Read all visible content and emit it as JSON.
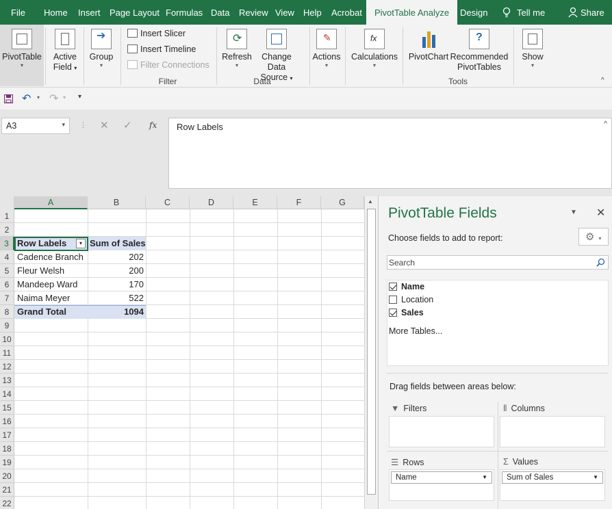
{
  "tabs": [
    "File",
    "Home",
    "Insert",
    "Page Layout",
    "Formulas",
    "Data",
    "Review",
    "View",
    "Help",
    "Acrobat",
    "PivotTable Analyze",
    "Design"
  ],
  "tell_me": "Tell me",
  "share": "Share",
  "ribbon": {
    "pivottable": "PivotTable",
    "active_field_1": "Active",
    "active_field_2": "Field",
    "group": "Group",
    "insert_slicer": "Insert Slicer",
    "insert_timeline": "Insert Timeline",
    "filter_connections": "Filter Connections",
    "filter_group": "Filter",
    "refresh": "Refresh",
    "change_data_1": "Change Data",
    "change_data_2": "Source",
    "data_group": "Data",
    "actions": "Actions",
    "calculations": "Calculations",
    "pivotchart": "PivotChart",
    "recommended_1": "Recommended",
    "recommended_2": "PivotTables",
    "tools_group": "Tools",
    "show": "Show"
  },
  "formula_bar": {
    "name_box": "A3",
    "fx": "fx",
    "content": "Row Labels"
  },
  "grid": {
    "columns": [
      "A",
      "B",
      "C",
      "D",
      "E",
      "F",
      "G"
    ],
    "rows": [
      "1",
      "2",
      "3",
      "4",
      "5",
      "6",
      "7",
      "8",
      "9",
      "10",
      "11",
      "12",
      "13",
      "14",
      "15",
      "16",
      "17",
      "18",
      "19",
      "20",
      "21",
      "22"
    ],
    "header": {
      "labels": "Row Labels",
      "sum": "Sum of Sales"
    },
    "data": [
      {
        "name": "Cadence Branch",
        "value": "202"
      },
      {
        "name": "Fleur Welsh",
        "value": "200"
      },
      {
        "name": "Mandeep Ward",
        "value": "170"
      },
      {
        "name": "Naima Meyer",
        "value": "522"
      }
    ],
    "total": {
      "name": "Grand Total",
      "value": "1094"
    }
  },
  "pane": {
    "title": "PivotTable Fields",
    "subtitle": "Choose fields to add to report:",
    "search_placeholder": "Search",
    "fields": [
      {
        "label": "Name",
        "checked": true
      },
      {
        "label": "Location",
        "checked": false
      },
      {
        "label": "Sales",
        "checked": true
      }
    ],
    "more_tables": "More Tables...",
    "drag_hint": "Drag fields between areas below:",
    "areas": {
      "filters": "Filters",
      "columns": "Columns",
      "rows": "Rows",
      "values": "Values",
      "rows_item": "Name",
      "values_item": "Sum of Sales"
    }
  },
  "colors": {
    "accent": "#217346",
    "pivot_header": "#d9e1f2"
  }
}
